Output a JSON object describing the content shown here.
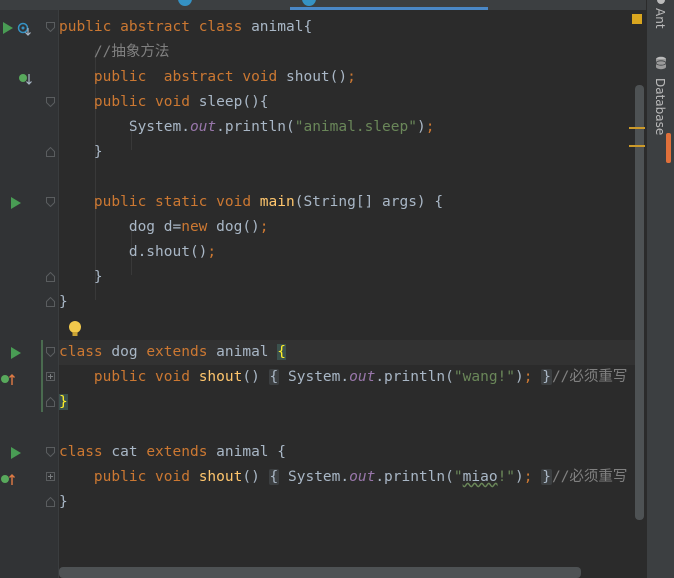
{
  "editor": {
    "language": "java",
    "lines": [
      {
        "tokens": [
          [
            "kw",
            "public "
          ],
          [
            "kw",
            "abstract "
          ],
          [
            "kw",
            "class "
          ],
          [
            "cls",
            "animal{"
          ]
        ]
      },
      {
        "tokens": [
          [
            "comment",
            "    //抽象方法"
          ]
        ]
      },
      {
        "tokens": [
          [
            "kw",
            "    public  "
          ],
          [
            "kw",
            "abstract "
          ],
          [
            "kw",
            "void "
          ],
          [
            "fn-gray",
            "shout"
          ],
          [
            "cls",
            "()"
          ],
          [
            "punct",
            ";"
          ]
        ]
      },
      {
        "tokens": [
          [
            "kw",
            "    public "
          ],
          [
            "kw",
            "void "
          ],
          [
            "fn-gray",
            "sleep"
          ],
          [
            "cls",
            "(){"
          ]
        ]
      },
      {
        "tokens": [
          [
            "cls",
            "        System."
          ],
          [
            "ital",
            "out"
          ],
          [
            "cls",
            ".println("
          ],
          [
            "str",
            "\"animal.sleep\""
          ],
          [
            "cls",
            ")"
          ],
          [
            "punct",
            ";"
          ]
        ]
      },
      {
        "tokens": [
          [
            "cls",
            "    }"
          ]
        ]
      },
      {
        "tokens": []
      },
      {
        "tokens": [
          [
            "kw",
            "    public "
          ],
          [
            "kw",
            "static "
          ],
          [
            "kw",
            "void "
          ],
          [
            "fn",
            "main"
          ],
          [
            "cls",
            "(String[] args) {"
          ]
        ]
      },
      {
        "tokens": [
          [
            "cls",
            "        dog d="
          ],
          [
            "kw",
            "new "
          ],
          [
            "cls",
            "dog()"
          ],
          [
            "punct",
            ";"
          ]
        ]
      },
      {
        "tokens": [
          [
            "cls",
            "        d.shout()"
          ],
          [
            "punct",
            ";"
          ]
        ]
      },
      {
        "tokens": [
          [
            "cls",
            "    }"
          ]
        ]
      },
      {
        "tokens": [
          [
            "cls",
            "}"
          ]
        ]
      },
      {
        "tokens": []
      },
      {
        "tokens": [
          [
            "kw",
            "class "
          ],
          [
            "cls",
            "dog "
          ],
          [
            "kw",
            "extends "
          ],
          [
            "cls",
            "animal "
          ],
          [
            "brace-hl",
            "{"
          ]
        ]
      },
      {
        "tokens": [
          [
            "kw",
            "    public "
          ],
          [
            "kw",
            "void "
          ],
          [
            "fn",
            "shout"
          ],
          [
            "cls",
            "() "
          ],
          [
            "fold-box",
            "{"
          ],
          [
            "cls",
            " System."
          ],
          [
            "ital",
            "out"
          ],
          [
            "cls",
            ".println("
          ],
          [
            "str",
            "\"wang!\""
          ],
          [
            "cls",
            ")"
          ],
          [
            "punct",
            ";"
          ],
          [
            "cls",
            " "
          ],
          [
            "fold-box",
            "}"
          ],
          [
            "comment",
            "//必须重写"
          ]
        ]
      },
      {
        "tokens": [
          [
            "brace-hl",
            "}"
          ]
        ]
      },
      {
        "tokens": []
      },
      {
        "tokens": [
          [
            "kw",
            "class "
          ],
          [
            "cls",
            "cat "
          ],
          [
            "kw",
            "extends "
          ],
          [
            "cls",
            "animal {"
          ]
        ]
      },
      {
        "tokens": [
          [
            "kw",
            "    public "
          ],
          [
            "kw",
            "void "
          ],
          [
            "fn",
            "shout"
          ],
          [
            "cls",
            "() "
          ],
          [
            "fold-box",
            "{"
          ],
          [
            "cls",
            " System."
          ],
          [
            "ital",
            "out"
          ],
          [
            "cls",
            ".println("
          ],
          [
            "str",
            "\""
          ],
          [
            "squiggle",
            "miao"
          ],
          [
            "str",
            "!\""
          ],
          [
            "cls",
            ")"
          ],
          [
            "punct",
            ";"
          ],
          [
            "cls",
            " "
          ],
          [
            "fold-box",
            "}"
          ],
          [
            "comment",
            "//必须重写"
          ]
        ]
      },
      {
        "tokens": [
          [
            "cls",
            "}"
          ]
        ]
      }
    ],
    "current_line_index": 13
  },
  "tool_windows": {
    "ant_label": "Ant",
    "database_label": "Database"
  },
  "colors": {
    "background": "#2b2b2b",
    "keyword": "#cc7832",
    "string": "#6a8759",
    "function": "#ffc66d",
    "static_field": "#9876aa",
    "comment": "#808080",
    "run_icon": "#499c54"
  }
}
